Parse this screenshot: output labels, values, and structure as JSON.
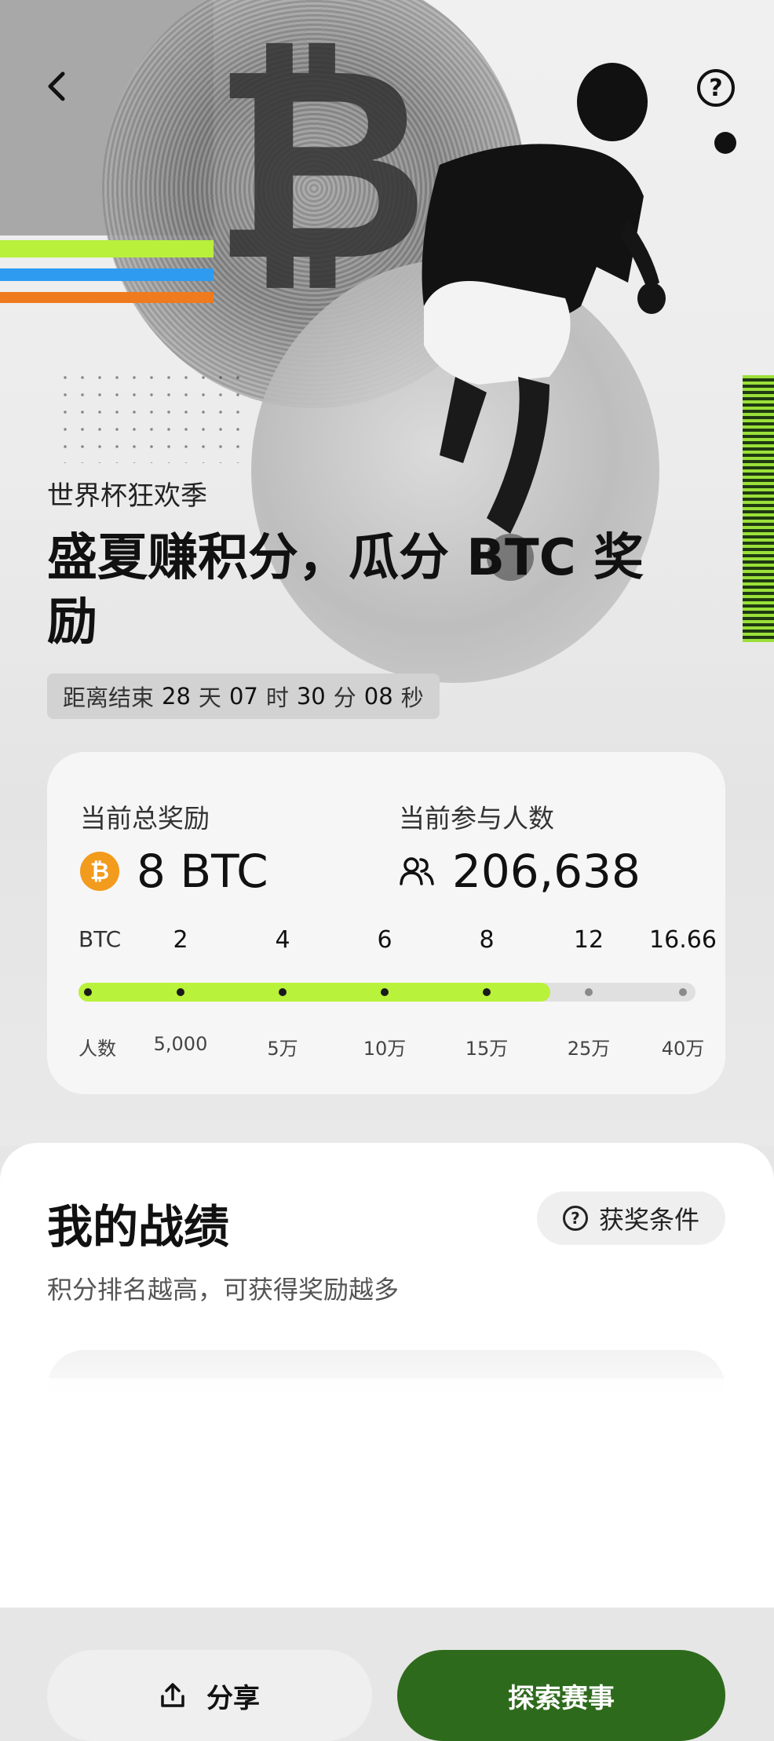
{
  "hero": {
    "eyebrow": "世界杯狂欢季",
    "title": "盛夏赚积分，瓜分 BTC 奖励",
    "countdown": {
      "prefix": "距离结束",
      "days": "28",
      "days_unit": "天",
      "hours": "07",
      "hours_unit": "时",
      "minutes": "30",
      "minutes_unit": "分",
      "seconds": "08",
      "seconds_unit": "秒"
    }
  },
  "reward": {
    "total_label": "当前总奖励",
    "total_value": "8 BTC",
    "participants_label": "当前参与人数",
    "participants_value": "206,638",
    "btc_row_label": "BTC",
    "people_row_label": "人数",
    "milestones": [
      {
        "btc": "2",
        "people": "5,000"
      },
      {
        "btc": "4",
        "people": "5万"
      },
      {
        "btc": "6",
        "people": "10万"
      },
      {
        "btc": "8",
        "people": "15万"
      },
      {
        "btc": "12",
        "people": "25万"
      },
      {
        "btc": "16.66",
        "people": "40万"
      }
    ],
    "reached_count": 4,
    "progress_fraction": 0.765
  },
  "sheet": {
    "title": "我的战绩",
    "rules_label": "获奖条件",
    "subtitle": "积分排名越高，可获得奖励越多"
  },
  "actions": {
    "share_label": "分享",
    "explore_label": "探索赛事"
  },
  "colors": {
    "accent_green": "#b9f23b",
    "primary_button": "#2e6a1c",
    "btc_orange": "#f29b1c"
  }
}
